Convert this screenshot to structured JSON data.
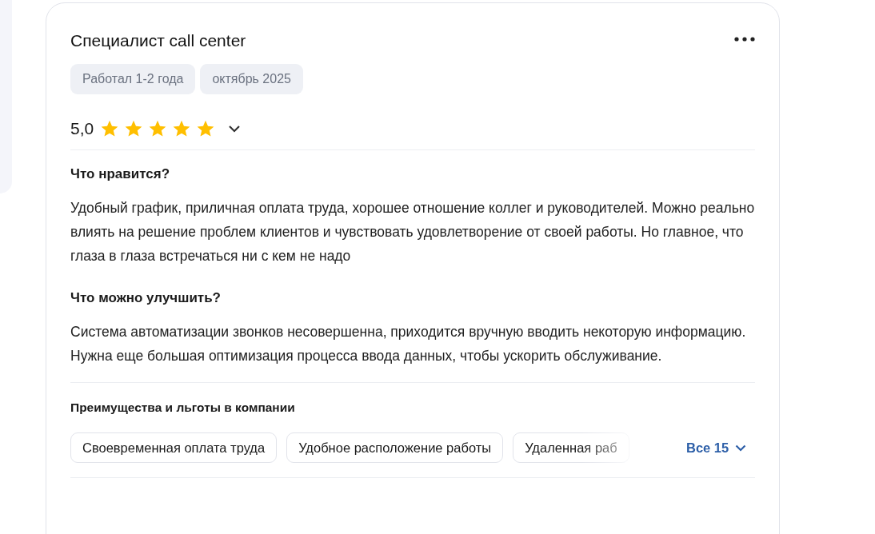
{
  "review": {
    "title": "Специалист call center",
    "tags": [
      "Работал 1-2 года",
      "октябрь 2025"
    ],
    "rating": {
      "score": "5,0",
      "stars": 5
    },
    "sections": [
      {
        "heading": "Что нравится?",
        "text": "Удобный график, приличная оплата труда, хорошее отношение коллег и руководителей. Можно реально влиять на решение проблем клиентов и чувствовать удовлетворение от своей работы. Но главное, что глаза в глаза встречаться ни с кем не надо"
      },
      {
        "heading": "Что можно улучшить?",
        "text": "Система автоматизации звонков несовершенна, приходится вручную вводить некоторую информацию. Нужна еще большая оптимизация процесса ввода данных, чтобы ускорить обслуживание."
      }
    ],
    "benefits": {
      "title": "Преимущества и льготы в компании",
      "items": [
        "Своевременная оплата труда",
        "Удобное расположение работы",
        "Удаленная раб"
      ],
      "more": "Все 15"
    }
  }
}
